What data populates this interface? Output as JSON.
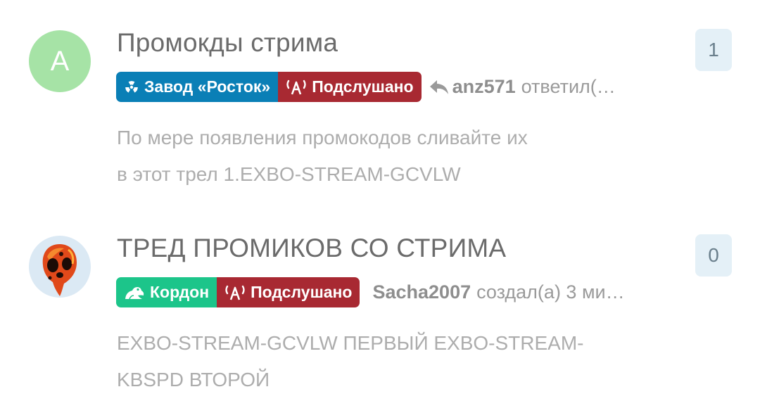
{
  "discussions": [
    {
      "avatar_letter": "A",
      "title": "Промокды стрима",
      "tags": [
        {
          "label": "Завод «Росток»",
          "icon": "radiation-icon",
          "color": "#0a7fb6"
        },
        {
          "label": "Подслушано",
          "icon": "broadcast-icon",
          "color": "#a82932"
        }
      ],
      "last_user": "anz571",
      "last_action": "ответил(…",
      "excerpt_line1": "По мере появления промокодов сливайте их",
      "excerpt_line2": "в этот трел 1.EXBO-STREAM-GCVLW",
      "reply_count": "1"
    },
    {
      "avatar_image": "molten-skull-avatar",
      "title": "ТРЕД ПРОМИКОВ СО СТРИМА",
      "tags": [
        {
          "label": "Кордон",
          "icon": "frog-icon",
          "color": "#1cc58a"
        },
        {
          "label": "Подслушано",
          "icon": "broadcast-icon",
          "color": "#a82932"
        }
      ],
      "last_user": "Sacha2007",
      "last_action": "создал(а) 3 ми…",
      "excerpt_line1": "EXBO-STREAM-GCVLW ПЕРВЫЙ EXBO-STREAM-",
      "excerpt_line2": "KBSPD ВТОРОЙ",
      "reply_count": "0"
    }
  ]
}
